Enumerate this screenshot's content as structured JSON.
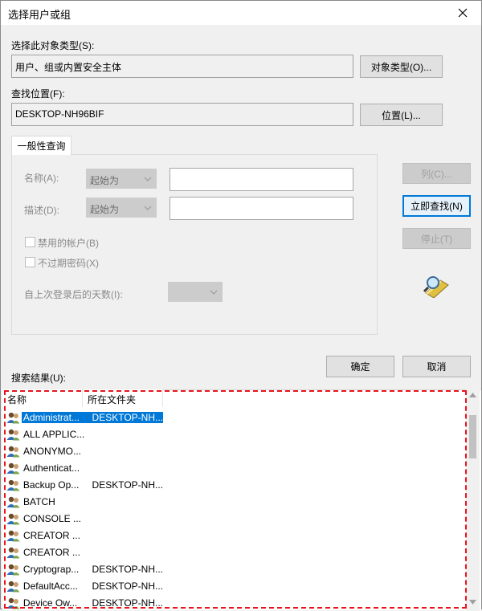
{
  "window": {
    "title": "选择用户或组"
  },
  "object_type": {
    "label": "选择此对象类型(S):",
    "value": "用户、组或内置安全主体",
    "button": "对象类型(O)..."
  },
  "location": {
    "label": "查找位置(F):",
    "value": "DESKTOP-NH96BIF",
    "button": "位置(L)..."
  },
  "tab": {
    "label": "一般性查询"
  },
  "query": {
    "name_label": "名称(A):",
    "name_op": "起始为",
    "desc_label": "描述(D):",
    "desc_op": "起始为",
    "disabled_accounts": "禁用的帐户(B)",
    "no_expire": "不过期密码(X)",
    "days_label": "自上次登录后的天数(I):"
  },
  "buttons": {
    "columns": "列(C)...",
    "find_now": "立即查找(N)",
    "stop": "停止(T)",
    "ok": "确定",
    "cancel": "取消"
  },
  "results": {
    "label": "搜索结果(U):",
    "columns": [
      "名称",
      "所在文件夹"
    ],
    "rows": [
      {
        "name": "Administrat...",
        "folder": "DESKTOP-NH...",
        "selected": true
      },
      {
        "name": "ALL APPLIC...",
        "folder": ""
      },
      {
        "name": "ANONYMO...",
        "folder": ""
      },
      {
        "name": "Authenticat...",
        "folder": ""
      },
      {
        "name": "Backup Op...",
        "folder": "DESKTOP-NH..."
      },
      {
        "name": "BATCH",
        "folder": ""
      },
      {
        "name": "CONSOLE ...",
        "folder": ""
      },
      {
        "name": "CREATOR ...",
        "folder": ""
      },
      {
        "name": "CREATOR ...",
        "folder": ""
      },
      {
        "name": "Cryptograp...",
        "folder": "DESKTOP-NH..."
      },
      {
        "name": "DefaultAcc...",
        "folder": "DESKTOP-NH..."
      },
      {
        "name": "Device Ow...",
        "folder": "DESKTOP-NH..."
      }
    ]
  },
  "colors": {
    "accent": "#0078d7",
    "highlight_dash": "#e8141c"
  }
}
